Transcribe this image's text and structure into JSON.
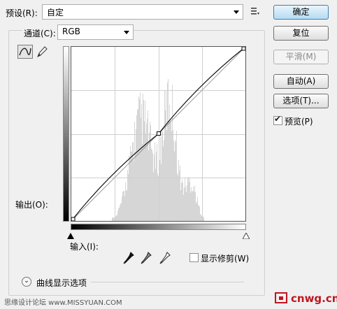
{
  "preset": {
    "label": "预设(R):",
    "value": "自定"
  },
  "channel": {
    "label": "通道(C):",
    "value": "RGB"
  },
  "buttons": {
    "ok": "确定",
    "reset": "复位",
    "smooth": "平滑(M)",
    "auto": "自动(A)",
    "options": "选项(T)..."
  },
  "preview": {
    "label": "预览(P)",
    "checked": true
  },
  "output_label": "输出(O):",
  "input_label": "输入(I):",
  "show_clipping": {
    "label": "显示修剪(W)",
    "checked": false
  },
  "curve_display_options": "曲线显示选项",
  "icons": {
    "curve_tool": "curve-point-icon",
    "pencil_tool": "pencil-icon",
    "preset_menu": "preset-menu-icon",
    "eyedroppers": [
      "black-eyedropper-icon",
      "gray-eyedropper-icon",
      "white-eyedropper-icon"
    ]
  },
  "curve": {
    "control_points": [
      [
        0,
        0
      ],
      [
        128,
        128
      ],
      [
        255,
        255
      ]
    ],
    "grid_divisions": 4
  },
  "watermark_left": "思缘设计论坛 www.MISSYUAN.COM",
  "watermark_right": "cnwg.cn"
}
